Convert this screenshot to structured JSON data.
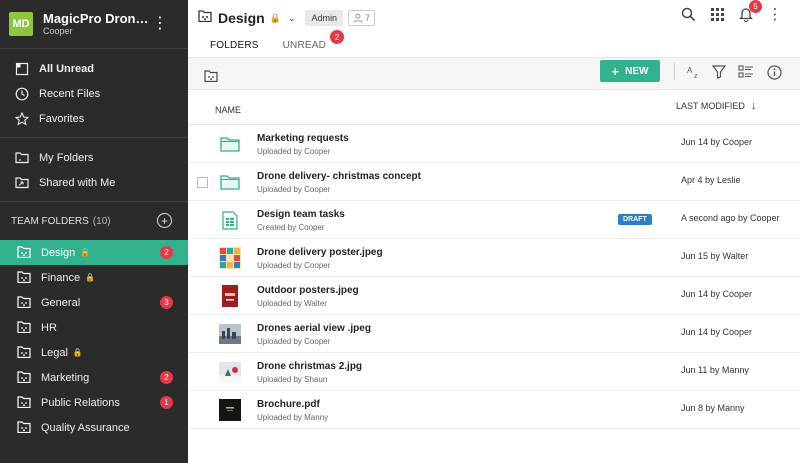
{
  "sidebar": {
    "avatar": "MD",
    "org_name": "MagicPro Dron…",
    "user": "Cooper",
    "menu_glyph": "⋮",
    "primary_items": [
      {
        "label": "All Unread",
        "icon": "inbox-icon"
      },
      {
        "label": "Recent Files",
        "icon": "clock-icon"
      },
      {
        "label": "Favorites",
        "icon": "star-icon"
      }
    ],
    "folder_items": [
      {
        "label": "My Folders",
        "icon": "folder-icon"
      },
      {
        "label": "Shared with Me",
        "icon": "shared-folder-icon"
      }
    ],
    "team_header": "TEAM FOLDERS",
    "team_count": "(10)",
    "team_add": "+",
    "team_folders": [
      {
        "label": "Design",
        "locked": true,
        "badge": "2",
        "active": true
      },
      {
        "label": "Finance",
        "locked": true,
        "badge": ""
      },
      {
        "label": "General",
        "locked": false,
        "badge": "3"
      },
      {
        "label": "HR",
        "locked": false,
        "badge": ""
      },
      {
        "label": "Legal",
        "locked": true,
        "badge": ""
      },
      {
        "label": "Marketing",
        "locked": false,
        "badge": "2"
      },
      {
        "label": "Public Relations",
        "locked": false,
        "badge": "1"
      },
      {
        "label": "Quality Assurance",
        "locked": false,
        "badge": ""
      }
    ]
  },
  "header": {
    "title": "Design",
    "lock_glyph": "🔒",
    "chevron_glyph": "⌄",
    "role": "Admin",
    "member_count": "7",
    "tabs": [
      {
        "label": "FOLDERS",
        "active": true,
        "badge": ""
      },
      {
        "label": "UNREAD",
        "active": false,
        "badge": "2"
      }
    ],
    "notification_count": "5",
    "kebab_glyph": "⋮"
  },
  "toolbar": {
    "new_label": "NEW",
    "new_plus": "+",
    "sort_icon": "sort-az-icon",
    "filter_icon": "filter-icon",
    "view_icon": "list-view-icon",
    "info_icon": "info-icon"
  },
  "list": {
    "col_name": "NAME",
    "col_modified": "LAST MODIFIED",
    "sort_arrow": "↓",
    "rows": [
      {
        "name": "Marketing requests",
        "sub": "Uploaded by Cooper",
        "modified": "Jun 14 by Cooper",
        "type": "folder",
        "checkbox": false,
        "draft": ""
      },
      {
        "name": "Drone delivery- christmas concept",
        "sub": "Uploaded by Cooper",
        "modified": "Apr 4 by Leslie",
        "type": "folder",
        "checkbox": true,
        "draft": ""
      },
      {
        "name": "Design team tasks",
        "sub": "Created by Cooper",
        "modified": "A second ago by Cooper",
        "type": "sheet",
        "checkbox": false,
        "draft": "DRAFT"
      },
      {
        "name": "Drone delivery poster.jpeg",
        "sub": "Uploaded by Cooper",
        "modified": "Jun 15 by Walter",
        "type": "img-poster",
        "checkbox": false,
        "draft": ""
      },
      {
        "name": "Outdoor posters.jpeg",
        "sub": "Uploaded by Walter",
        "modified": "Jun 14 by Cooper",
        "type": "img-red",
        "checkbox": false,
        "draft": ""
      },
      {
        "name": "Drones aerial view .jpeg",
        "sub": "Uploaded by Cooper",
        "modified": "Jun 14 by Cooper",
        "type": "img-aerial",
        "checkbox": false,
        "draft": ""
      },
      {
        "name": "Drone christmas 2.jpg",
        "sub": "Uploaded by Shaun",
        "modified": "Jun 11 by Manny",
        "type": "img-xmas",
        "checkbox": false,
        "draft": ""
      },
      {
        "name": "Brochure.pdf",
        "sub": "Uploaded by Manny",
        "modified": "Jun 8 by Manny",
        "type": "pdf-dark",
        "checkbox": false,
        "draft": ""
      }
    ]
  },
  "colors": {
    "accent": "#31b18c",
    "sidebar_bg": "#2b2b2b",
    "badge_red": "#e53946",
    "draft_blue": "#2a7fc9"
  }
}
